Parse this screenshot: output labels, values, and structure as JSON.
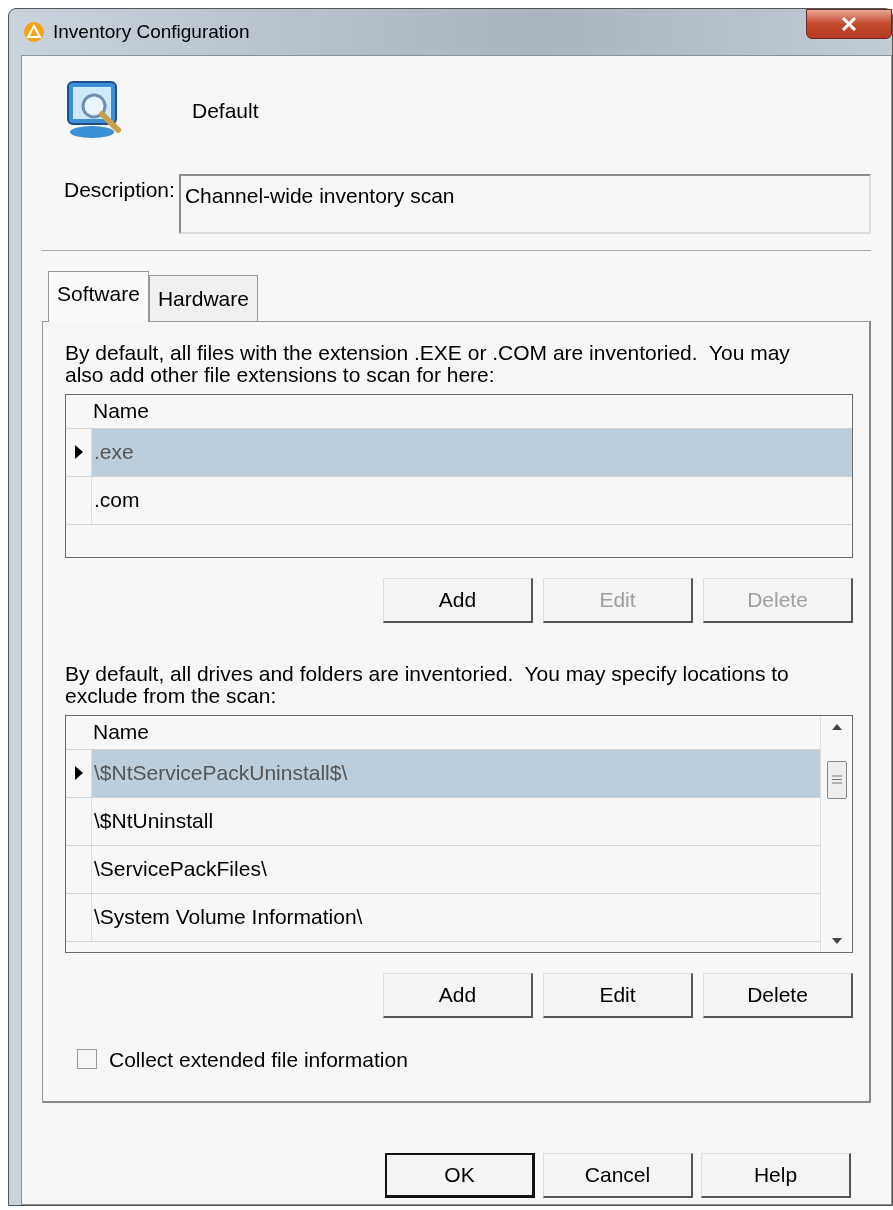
{
  "window": {
    "title": "Inventory Configuration"
  },
  "header": {
    "name": "Default"
  },
  "description": {
    "label": "Description:",
    "value": "Channel-wide inventory scan"
  },
  "tabs": [
    {
      "label": "Software",
      "selected": true
    },
    {
      "label": "Hardware",
      "selected": false
    }
  ],
  "sections": [
    {
      "text": "By default, all files with the extension .EXE or .COM are inventoried.  You may also add other file extensions to scan for here:",
      "column": "Name",
      "scrollbar": false,
      "rows": [
        {
          "name": ".exe",
          "selected": true
        },
        {
          "name": ".com",
          "selected": false
        }
      ],
      "buttons": [
        {
          "label": "Add",
          "disabled": false
        },
        {
          "label": "Edit",
          "disabled": true
        },
        {
          "label": "Delete",
          "disabled": true
        }
      ]
    },
    {
      "text": "By default, all drives and folders are inventoried.  You may specify locations to exclude from the scan:",
      "column": "Name",
      "scrollbar": true,
      "rows": [
        {
          "name": "\\$NtServicePackUninstall$\\",
          "selected": true
        },
        {
          "name": "\\$NtUninstall",
          "selected": false
        },
        {
          "name": "\\ServicePackFiles\\",
          "selected": false
        },
        {
          "name": "\\System Volume Information\\",
          "selected": false
        }
      ],
      "buttons": [
        {
          "label": "Add",
          "disabled": false
        },
        {
          "label": "Edit",
          "disabled": false
        },
        {
          "label": "Delete",
          "disabled": false
        }
      ]
    }
  ],
  "option": {
    "label": "Collect extended file information",
    "checked": false
  },
  "dialog_buttons": [
    {
      "label": "OK",
      "default": true
    },
    {
      "label": "Cancel",
      "default": false
    },
    {
      "label": "Help",
      "default": false
    }
  ]
}
